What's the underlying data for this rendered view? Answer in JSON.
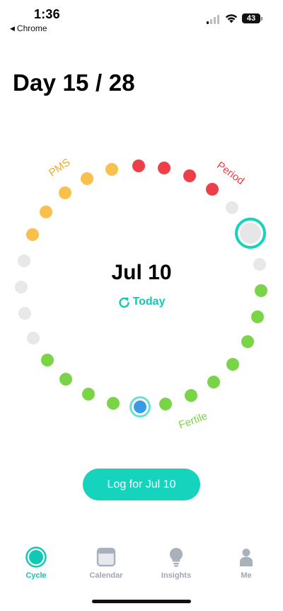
{
  "status_bar": {
    "time": "1:36",
    "back_app": "Chrome",
    "battery": "43"
  },
  "header": {
    "day_title": "Day 15 / 28"
  },
  "cycle": {
    "selected_date": "Jul 10",
    "today_label": "Today",
    "phase_labels": {
      "pms": "PMS",
      "period": "Period",
      "fertile": "Fertile"
    },
    "colors": {
      "pms": "#f9c04e",
      "period": "#ee3e48",
      "fertile": "#7ad448",
      "neutral": "#e8e8e8",
      "accent": "#15d3bc",
      "current": "#3b9ae8"
    }
  },
  "actions": {
    "log_button": "Log for Jul 10"
  },
  "tab_bar": {
    "tabs": [
      {
        "label": "Cycle",
        "icon": "cycle-icon",
        "active": true
      },
      {
        "label": "Calendar",
        "icon": "calendar-icon",
        "active": false
      },
      {
        "label": "Insights",
        "icon": "lightbulb-icon",
        "active": false
      },
      {
        "label": "Me",
        "icon": "person-icon",
        "active": false
      }
    ]
  }
}
